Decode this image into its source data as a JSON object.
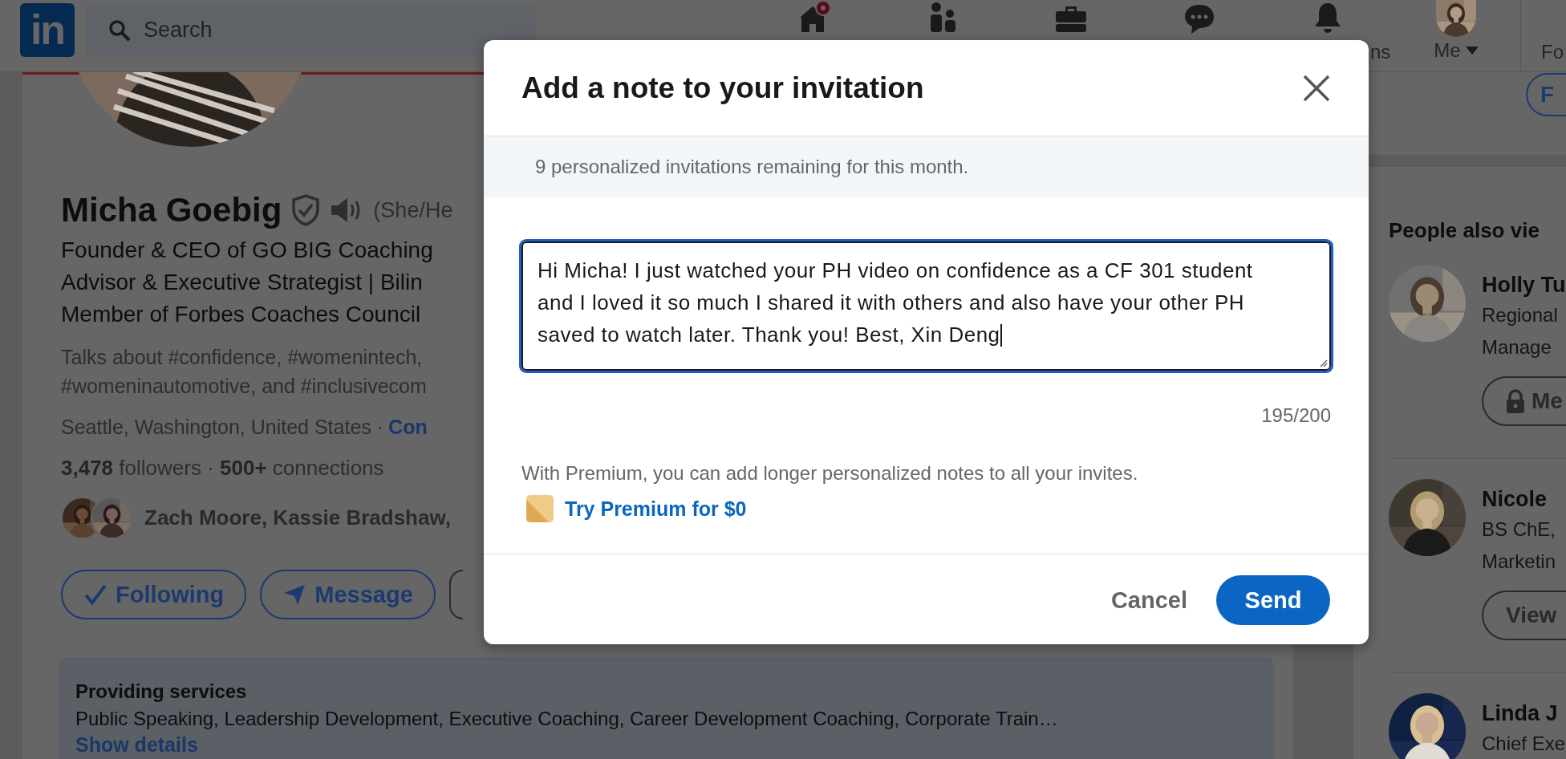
{
  "nav": {
    "logo": "in",
    "search_placeholder": "Search",
    "notifications_label": "ns",
    "me_label": "Me",
    "business_label": "Fo"
  },
  "profile": {
    "name": "Micha Goebig",
    "pronouns": "(She/He",
    "headline": [
      "Founder & CEO of GO BIG Coaching",
      "Advisor & Executive Strategist | Bilin",
      "Member of Forbes Coaches Council"
    ],
    "talks_about": [
      "Talks about #confidence, #womenintech,",
      "#womeninautomotive, and #inclusivecom"
    ],
    "location": "Seattle, Washington, United States ·",
    "contact_link": "Con",
    "stats": "**3,478** followers  · **500+** connections",
    "mutual": "Zach Moore, Kassie Bradshaw,",
    "buttons": [
      {
        "kind": "following",
        "label": "Following"
      },
      {
        "kind": "message",
        "label": "Message"
      },
      {
        "kind": "more"
      }
    ]
  },
  "services": {
    "title": "Providing services",
    "text": "Public Speaking, Leadership Development, Executive Coaching, Career Development Coaching, Corporate Train…",
    "link": "Show details"
  },
  "sidebar": {
    "top_button": "F",
    "heading": "People also vie",
    "people": [
      {
        "name": "Holly Tu",
        "lines": [
          "Regional",
          "Manage"
        ],
        "button": {
          "kind": "locked",
          "label": "Me"
        }
      },
      {
        "name": "Nicole",
        "lines": [
          "BS ChE,",
          "Marketin"
        ],
        "button": {
          "kind": "plain",
          "label": "View"
        }
      },
      {
        "name": "Linda J",
        "lines": [
          "Chief Exe"
        ]
      }
    ]
  },
  "modal": {
    "title": "Add a note to your invitation",
    "notice": "9 personalized invitations remaining for this month.",
    "message": "Hi Micha! I just watched your PH video on confidence as a CF 301 student and I loved it so much I shared it with others and also have your other PH saved to watch later. Thank you! Best, Xin Deng",
    "focused": true,
    "counter": "195/200",
    "premium_text": "With Premium, you can add longer personalized notes to all your invites.",
    "premium_link": "Try Premium for $0",
    "buttons": [
      {
        "kind": "secondary",
        "label": "Cancel"
      },
      {
        "kind": "primary",
        "label": "Send"
      }
    ]
  }
}
